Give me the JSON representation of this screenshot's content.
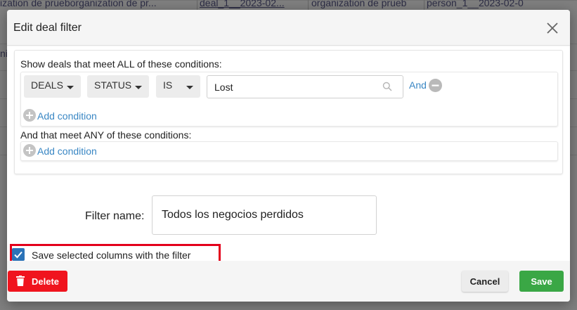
{
  "background": {
    "row1_cells": [
      "ization de prueborganization de pr...",
      "deal_1__2023-02...",
      "organization de prueb",
      "person_1__2023-02-0"
    ],
    "row2_cells": [
      "ni"
    ]
  },
  "dialog": {
    "title": "Edit deal filter",
    "close_icon": "close-icon",
    "all_conditions_label": "Show deals that meet ALL of these conditions:",
    "condition": {
      "entity": "DEALS",
      "field": "STATUS",
      "operator": "IS",
      "value": "Lost",
      "and_label": "And"
    },
    "add_condition_label": "Add condition",
    "any_conditions_label": "And that meet ANY of these conditions:",
    "add_condition_any_label": "Add condition",
    "filter_name_label": "Filter name:",
    "filter_name_value": "Todos los negocios perdidos",
    "save_columns_label": "Save selected columns with the filter",
    "save_columns_checked": true,
    "delete_label": "Delete",
    "cancel_label": "Cancel",
    "save_label": "Save"
  },
  "colors": {
    "link": "#3a87c4",
    "delete": "#f0141e",
    "save": "#3aa745",
    "checkbox": "#2b73b8",
    "highlight": "#e3001b"
  }
}
